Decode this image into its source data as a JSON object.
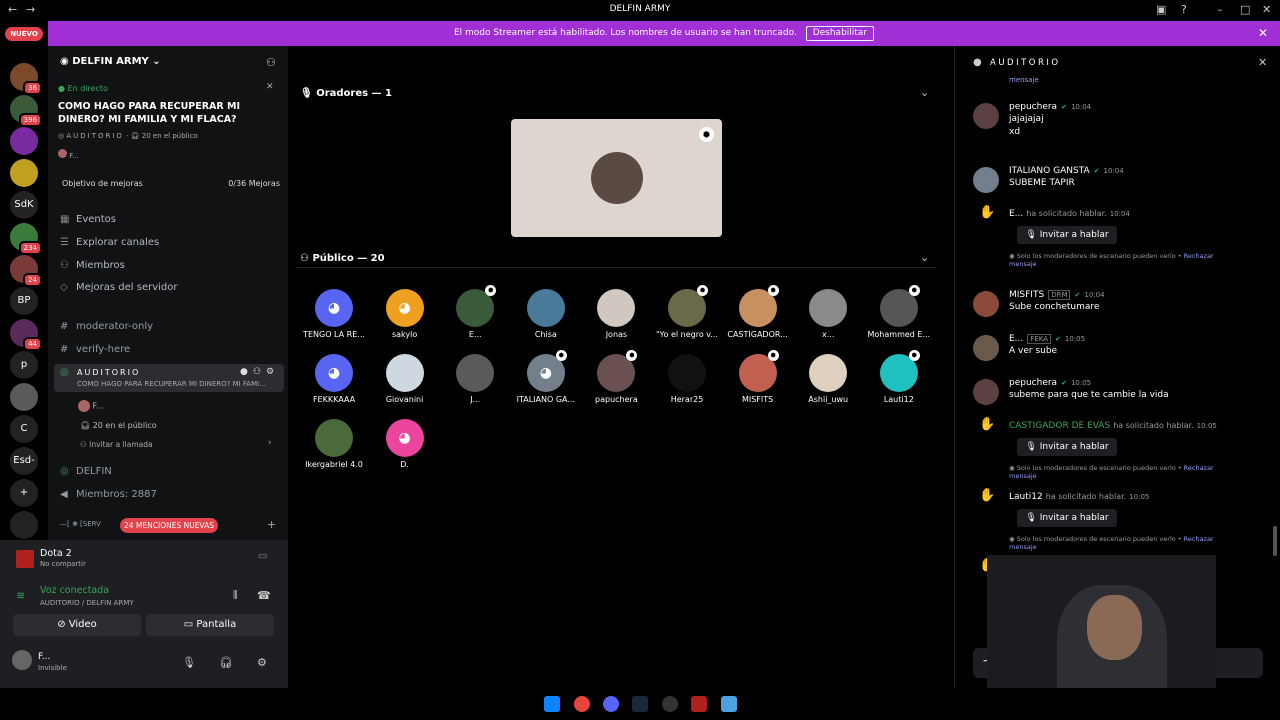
{
  "window": {
    "title": "DELFIN ARMY"
  },
  "banner": {
    "text": "El modo Streamer está habilitado. Los nombres de usuario se han truncado.",
    "button": "Deshabilitar"
  },
  "rail": {
    "nuevo": "NUEVO",
    "servers": [
      {
        "label": "",
        "badge": "36"
      },
      {
        "label": "",
        "badge": "396"
      },
      {
        "label": "",
        "badge": ""
      },
      {
        "label": "",
        "badge": ""
      },
      {
        "label": "SdK",
        "badge": ""
      },
      {
        "label": "",
        "badge": "234"
      },
      {
        "label": "",
        "badge": "24"
      },
      {
        "label": "BP",
        "badge": ""
      },
      {
        "label": "",
        "badge": "44"
      },
      {
        "label": "p",
        "badge": ""
      },
      {
        "label": "",
        "badge": ""
      },
      {
        "label": "C",
        "badge": ""
      },
      {
        "label": "Esd-E-",
        "badge": ""
      },
      {
        "label": "+",
        "badge": ""
      },
      {
        "label": "",
        "badge": ""
      }
    ]
  },
  "sidebar": {
    "server_name": "DELFIN ARMY",
    "live_label": "En directo",
    "stage_title": "COMO HAGO PARA RECUPERAR MI DINERO? MI FAMILIA Y MI FLACA?",
    "stage_channel": "AUDITORIO",
    "audience_count": "20 en el público",
    "host": "F...",
    "goal_label": "Objetivo de mejoras",
    "goal_value": "0/36 Mejoras",
    "nav": [
      "Eventos",
      "Explorar canales",
      "Miembros",
      "Mejoras del servidor"
    ],
    "channels": [
      "moderator-only",
      "verify-here"
    ],
    "active": {
      "name": "AUDITORIO",
      "topic": "COMO HAGO PARA RECUPERAR MI DINERO? MI FAMI..."
    },
    "sub": {
      "host": "F...",
      "audience": "20 en el público",
      "invite": "Invitar a llamada"
    },
    "delfin": "DELFIN",
    "members": "Miembros: 2887",
    "cut": "[SERV",
    "mentions": "24 MENCIONES NUEVAS"
  },
  "panel": {
    "game": "Dota 2",
    "game_sub": "No compartir",
    "voice": "Voz conectada",
    "voice_sub": "AUDITORIO / DELFIN ARMY",
    "video": "Video",
    "screen": "Pantalla",
    "user": "F...",
    "status": "Invisible"
  },
  "stage": {
    "speakers_label": "Oradores — 1",
    "audience_label": "Público — 20",
    "audience": [
      {
        "name": "TENGO LA RE...",
        "color": "#5865f2",
        "discord": true,
        "mod": false
      },
      {
        "name": "sakylo",
        "color": "#f0a020",
        "discord": true,
        "mod": false
      },
      {
        "name": "E...",
        "color": "#3a5a3a",
        "discord": false,
        "mod": true
      },
      {
        "name": "Chisa",
        "color": "#4a7a9a",
        "discord": false,
        "mod": false
      },
      {
        "name": "Jonas",
        "color": "#d0c8c0",
        "discord": false,
        "mod": false
      },
      {
        "name": "\"Yo el negro v...",
        "color": "#6a6a4a",
        "discord": false,
        "mod": true
      },
      {
        "name": "CASTIGADOR...",
        "color": "#c89060",
        "discord": false,
        "mod": true
      },
      {
        "name": "x...",
        "color": "#8a8a8a",
        "discord": false,
        "mod": false
      },
      {
        "name": "Mohammed E...",
        "color": "#555",
        "discord": false,
        "mod": true
      },
      {
        "name": "FEKKKAAA",
        "color": "#5865f2",
        "discord": true,
        "mod": false
      },
      {
        "name": "Giovanini",
        "color": "#cfd8e0",
        "discord": false,
        "mod": false
      },
      {
        "name": "J...",
        "color": "#5a5a5a",
        "discord": false,
        "mod": false
      },
      {
        "name": "ITALIANO GA...",
        "color": "#747f8d",
        "discord": true,
        "mod": true
      },
      {
        "name": "papuchera",
        "color": "#6a5050",
        "discord": false,
        "mod": true
      },
      {
        "name": "Herar25",
        "color": "#111",
        "discord": false,
        "mod": false
      },
      {
        "name": "MISFITS",
        "color": "#c06050",
        "discord": false,
        "mod": true
      },
      {
        "name": "Ashii_uwu",
        "color": "#e0d0c0",
        "discord": false,
        "mod": false
      },
      {
        "name": "Lauti12",
        "color": "#20c0c0",
        "discord": false,
        "mod": true
      },
      {
        "name": "Ikergabriel 4.0",
        "color": "#4a6a3a",
        "discord": false,
        "mod": false
      },
      {
        "name": "D.",
        "color": "#eb459e",
        "discord": true,
        "mod": false
      }
    ]
  },
  "chat": {
    "header": "AUDITORIO",
    "top_note": "mensaje",
    "messages": [
      {
        "name": "pepuchera",
        "time": "10:04",
        "lines": [
          "jajajajaj",
          "xd"
        ]
      },
      {
        "name": "ITALIANO GANSTA",
        "time": "10:04",
        "lines": [
          "SUBEME TAPIR"
        ]
      },
      {
        "name": "MISFITS",
        "time": "10:04",
        "tag": "DRM",
        "lines": [
          "Sube conchetumare"
        ]
      },
      {
        "name": "E...",
        "time": "10:05",
        "tag": "FEKA",
        "lines": [
          "A ver sube"
        ]
      },
      {
        "name": "pepuchera",
        "time": "10:05",
        "lines": [
          "subeme para que te cambie la vida"
        ]
      }
    ],
    "requests": [
      {
        "name": "E...",
        "text": "ha solicitado hablar.",
        "time": "10:04"
      },
      {
        "name": "CASTIGADOR DE EVAS",
        "text": "ha solicitado hablar.",
        "time": "10:05"
      },
      {
        "name": "Lauti12",
        "text": "ha solicitado hablar.",
        "time": "10:05"
      }
    ],
    "invite_label": "Invitar a hablar",
    "note": "Solo los moderadores de escenario pueden verlo •",
    "reject": "Rechazar",
    "reject2": "mensaje"
  },
  "colors": {
    "banner": "#a02fd6",
    "badge": "#e2424b",
    "online": "#3ba55d",
    "castigador": "#3ba55d"
  }
}
